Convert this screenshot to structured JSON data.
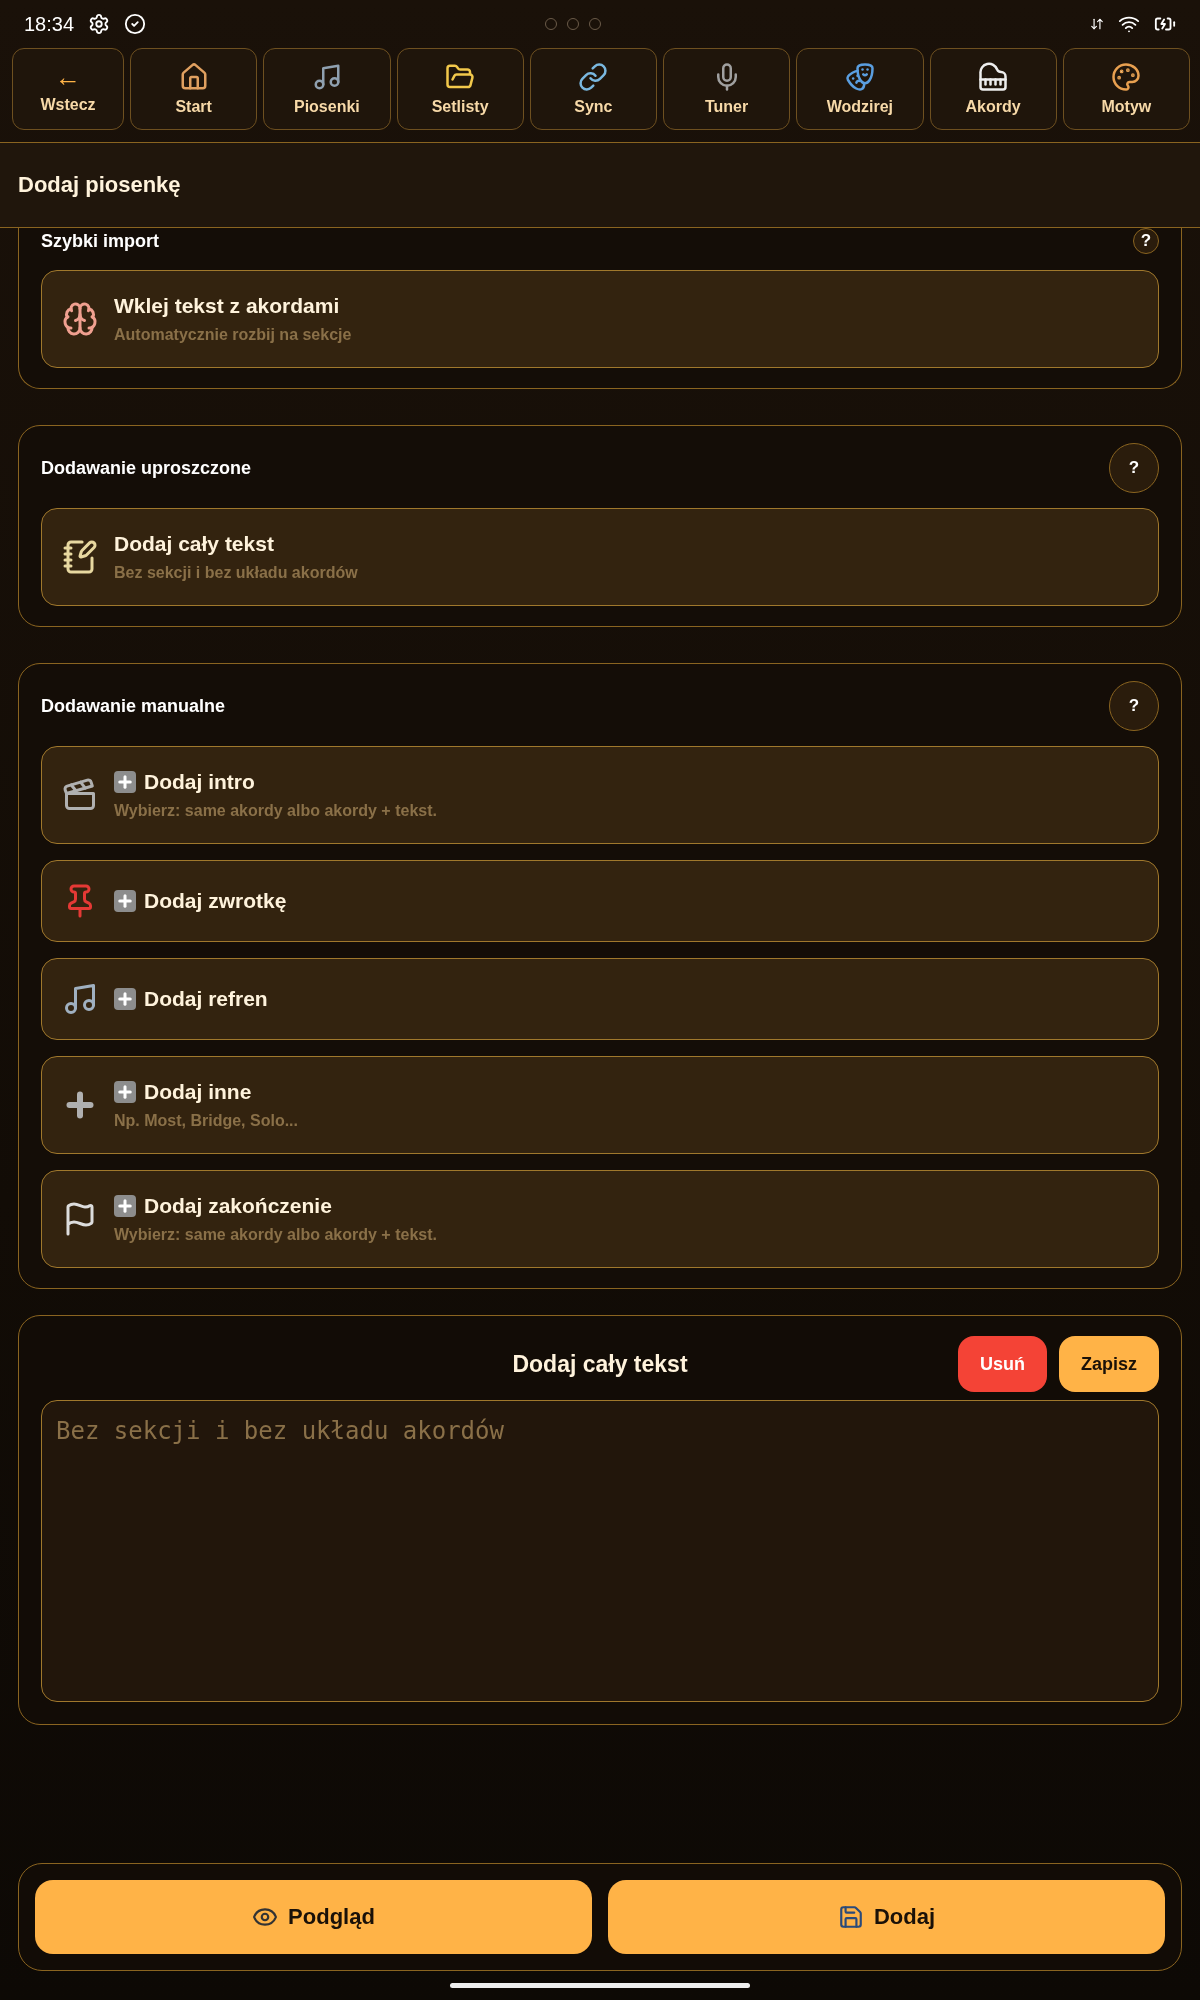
{
  "status_bar": {
    "time": "18:34"
  },
  "nav": [
    {
      "label": "Wstecz",
      "glyph": "←"
    },
    {
      "label": "Start"
    },
    {
      "label": "Piosenki"
    },
    {
      "label": "Setlisty"
    },
    {
      "label": "Sync"
    },
    {
      "label": "Tuner"
    },
    {
      "label": "Wodzirej"
    },
    {
      "label": "Akordy"
    },
    {
      "label": "Motyw"
    }
  ],
  "header": {
    "title": "Dodaj piosenkę"
  },
  "sections": [
    {
      "title": "Szybki import",
      "help": "?",
      "items": [
        {
          "title": "Wklej tekst z akordami",
          "subtitle": "Automatycznie rozbij na sekcje"
        }
      ]
    },
    {
      "title": "Dodawanie uproszczone",
      "help": "?",
      "items": [
        {
          "title": "Dodaj cały tekst",
          "subtitle": "Bez sekcji i bez układu akordów"
        }
      ]
    },
    {
      "title": "Dodawanie manualne",
      "help": "?",
      "items": [
        {
          "title": "Dodaj intro",
          "subtitle": "Wybierz: same akordy albo akordy + tekst."
        },
        {
          "title": "Dodaj zwrotkę"
        },
        {
          "title": "Dodaj refren"
        },
        {
          "title": "Dodaj inne",
          "subtitle": "Np. Most, Bridge, Solo..."
        },
        {
          "title": "Dodaj zakończenie",
          "subtitle": "Wybierz: same akordy albo akordy + tekst."
        }
      ]
    }
  ],
  "editor": {
    "title": "Dodaj cały tekst",
    "delete": "Usuń",
    "save": "Zapisz",
    "placeholder": "Bez sekcji i bez układu akordów"
  },
  "footer": {
    "preview": "Podgląd",
    "add": "Dodaj"
  }
}
